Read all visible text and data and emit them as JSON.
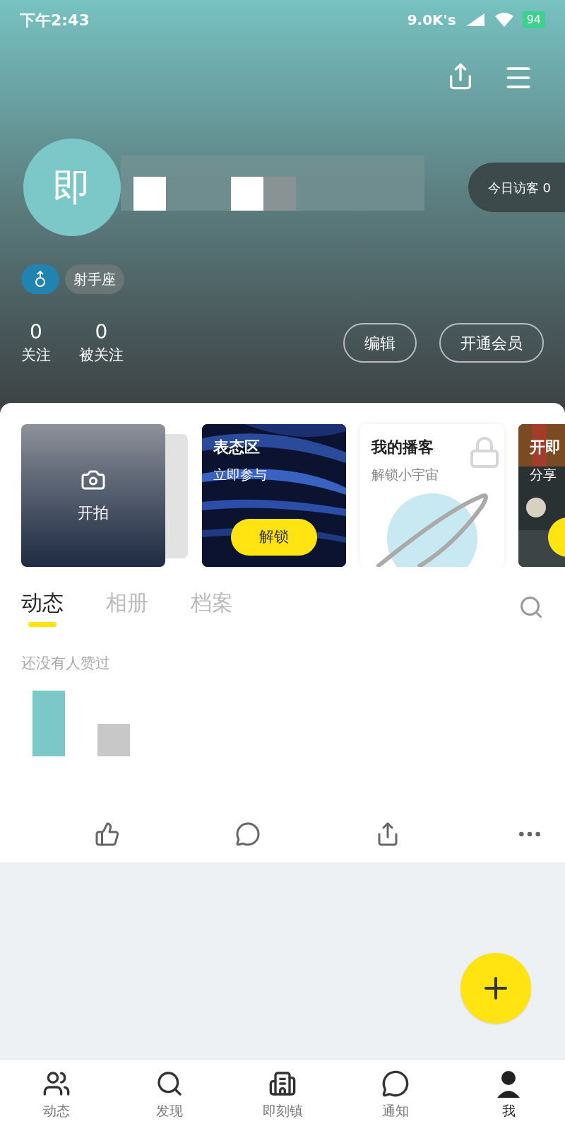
{
  "status_bar": {
    "time": "下午2:43",
    "speed": "9.0K's",
    "battery": "94"
  },
  "profile": {
    "avatar_text": "即",
    "visitors": "今日访客 0",
    "zodiac": "射手座",
    "stats": [
      {
        "value": "0",
        "label": "关注"
      },
      {
        "value": "0",
        "label": "被关注"
      }
    ],
    "buttons": [
      "编辑",
      "开通会员"
    ]
  },
  "cards": [
    {
      "kind": "shoot",
      "title": "开拍"
    },
    {
      "kind": "promo",
      "title": "表态区",
      "subtitle": "立即参与",
      "button": "解锁"
    },
    {
      "kind": "locked",
      "title": "我的播客",
      "subtitle": "解锁小宇宙"
    },
    {
      "kind": "partial",
      "title": "开即",
      "subtitle": "分享"
    }
  ],
  "tabs": [
    {
      "label": "动态",
      "selected": true
    },
    {
      "label": "相册",
      "selected": false
    },
    {
      "label": "档案",
      "selected": false
    }
  ],
  "post": {
    "likes_note": "还没有人赞过"
  },
  "nav": [
    {
      "label": "动态",
      "selected": false
    },
    {
      "label": "发现",
      "selected": false
    },
    {
      "label": "即刻镇",
      "selected": false
    },
    {
      "label": "通知",
      "selected": false
    },
    {
      "label": "我",
      "selected": true
    }
  ]
}
